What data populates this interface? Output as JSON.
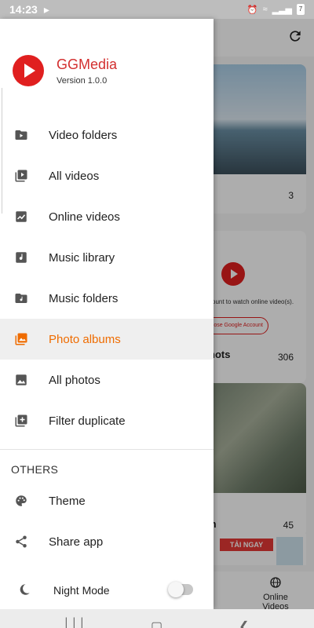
{
  "status_bar": {
    "time": "14:23",
    "battery": "7"
  },
  "app": {
    "name": "GGMedia",
    "version": "Version 1.0.0"
  },
  "menu": {
    "items": [
      {
        "label": "Video folders",
        "icon": "video-folder-icon"
      },
      {
        "label": "All videos",
        "icon": "video-library-icon"
      },
      {
        "label": "Online videos",
        "icon": "trending-icon"
      },
      {
        "label": "Music library",
        "icon": "music-note-icon"
      },
      {
        "label": "Music folders",
        "icon": "music-folder-icon"
      },
      {
        "label": "Photo albums",
        "icon": "photo-album-icon",
        "active": true
      },
      {
        "label": "All photos",
        "icon": "image-icon"
      },
      {
        "label": "Filter duplicate",
        "icon": "duplicate-icon"
      }
    ],
    "others_header": "OTHERS",
    "others": [
      {
        "label": "Theme",
        "icon": "palette-icon"
      },
      {
        "label": "Share app",
        "icon": "share-icon"
      }
    ],
    "night_mode": {
      "label": "Night Mode",
      "enabled": false
    }
  },
  "background": {
    "card1_count": "3",
    "card2_message": "ccount to watch online video(s).",
    "card2_button": "oose Google Account",
    "card2_title": "hots",
    "card2_count": "306",
    "card3_title": "m",
    "card3_count": "45",
    "banner_label": "TẢI NGAY",
    "bottom_nav_label": "Online Videos"
  },
  "colors": {
    "brand_red": "#e01f1f",
    "active_orange": "#ef6c00",
    "icon_gray": "#555555"
  }
}
